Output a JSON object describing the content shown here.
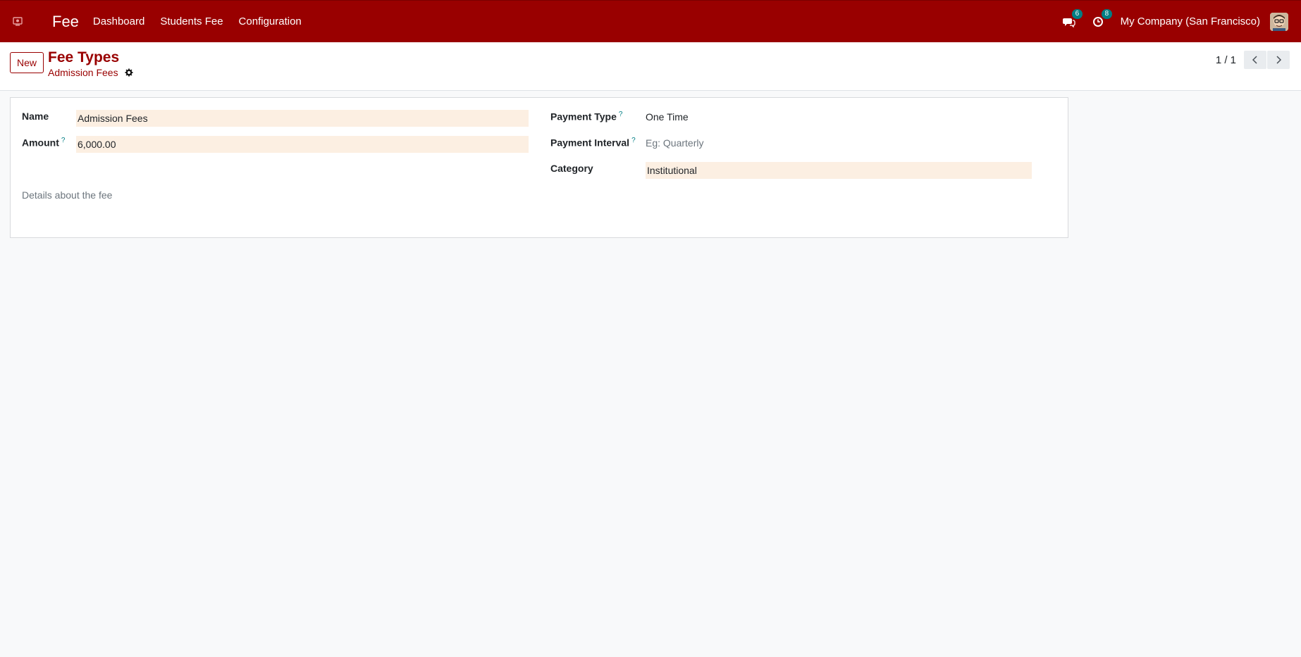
{
  "navbar": {
    "app_title": "Fee",
    "menu": [
      "Dashboard",
      "Students Fee",
      "Configuration"
    ],
    "messages_count": "6",
    "activities_count": "8",
    "company": "My Company (San Francisco)"
  },
  "control_panel": {
    "new_label": "New",
    "breadcrumb": "Fee Types",
    "record_name": "Admission Fees",
    "pager": "1 / 1"
  },
  "form": {
    "name_label": "Name",
    "name_value": "Admission Fees",
    "amount_label": "Amount",
    "amount_value": "6,000.00",
    "payment_type_label": "Payment Type",
    "payment_type_value": "One Time",
    "payment_interval_label": "Payment Interval",
    "payment_interval_placeholder": "Eg: Quarterly",
    "category_label": "Category",
    "category_value": "Institutional",
    "description_placeholder": "Details about the fee",
    "help_marker": "?"
  },
  "colors": {
    "brand": "#990000",
    "accent": "#017e84",
    "input_bg": "#fcefe2"
  }
}
